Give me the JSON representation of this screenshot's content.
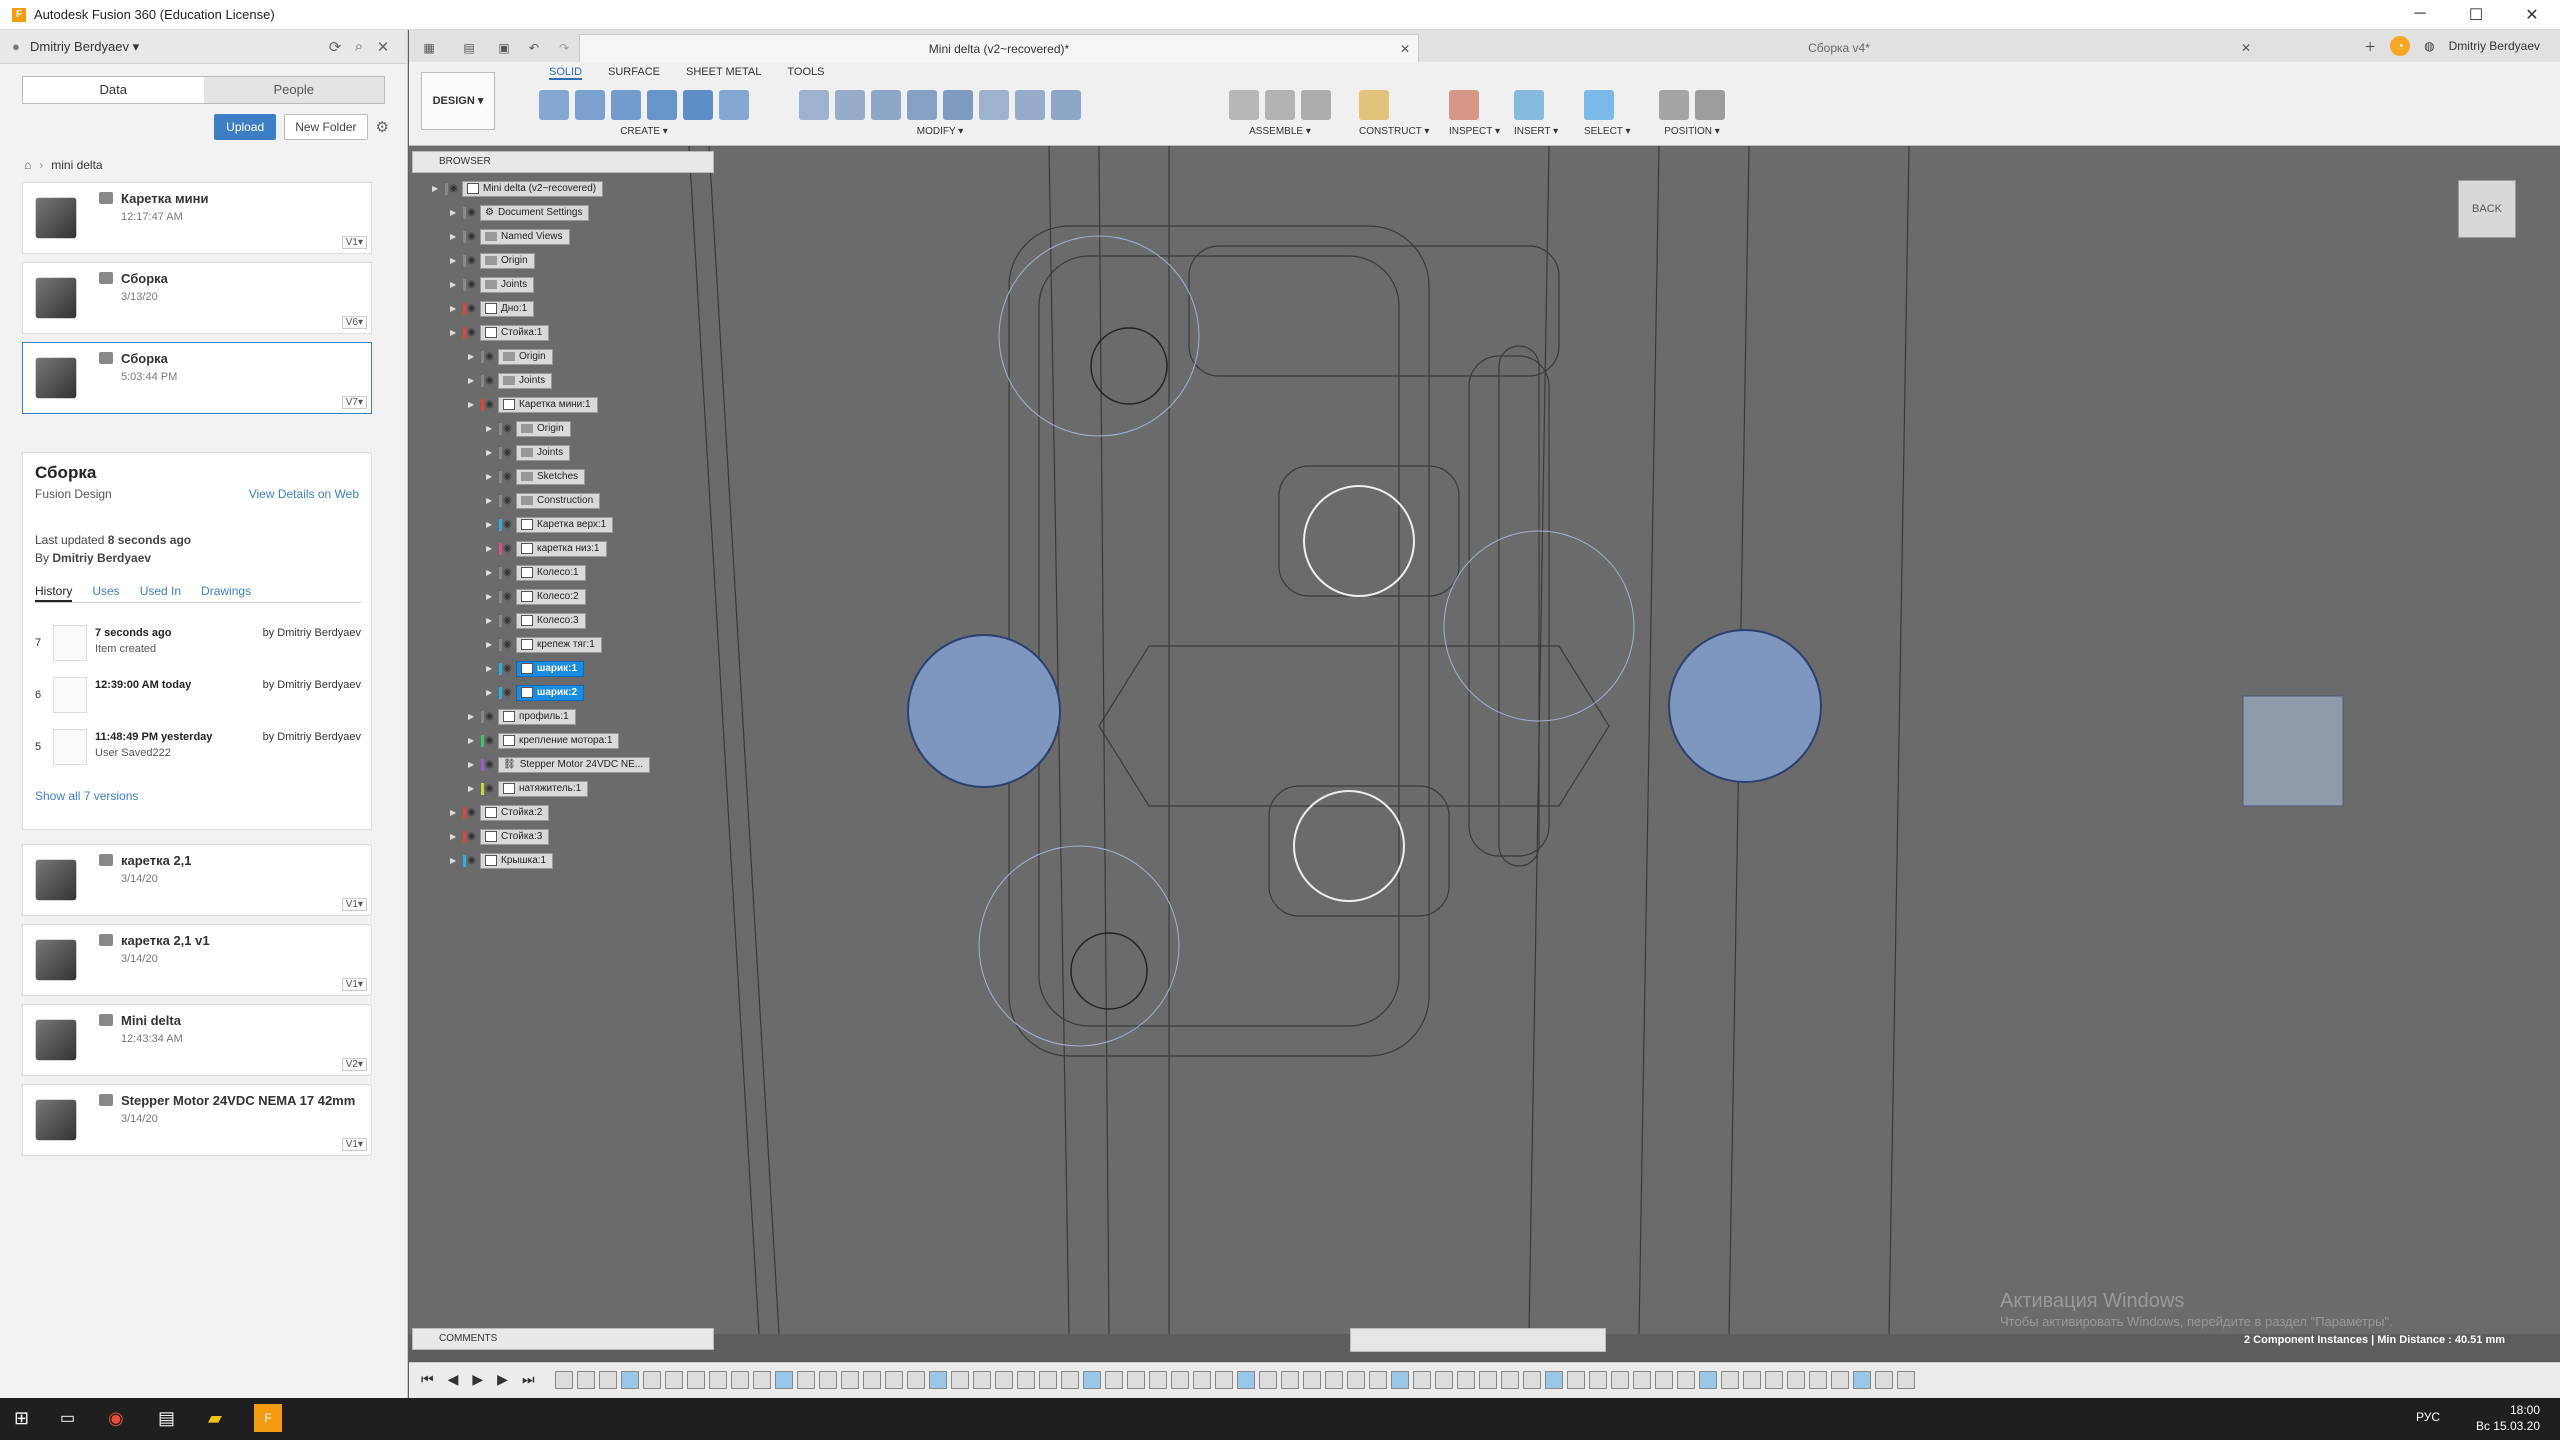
{
  "window": {
    "title": "Autodesk Fusion 360 (Education License)",
    "minimize": "─",
    "maximize": "☐",
    "close": "✕"
  },
  "left_panel": {
    "user": "Dmitriy Berdyaev ▾",
    "tabs": [
      "Data",
      "People"
    ],
    "upload": "Upload",
    "new_folder": "New Folder",
    "breadcrumb": "mini delta",
    "files_top": [
      {
        "name": "Каретка мини",
        "date": "12:17:47 AM",
        "version": "V1▾"
      },
      {
        "name": "Сборка",
        "date": "3/13/20",
        "version": "V6▾"
      },
      {
        "name": "Сборка",
        "date": "5:03:44 PM",
        "version": "V7▾"
      }
    ],
    "details": {
      "title": "Сборка",
      "type": "Fusion Design",
      "view_link": "View Details on Web",
      "updated_label": "Last updated",
      "updated_value": "8 seconds ago",
      "by_label": "By",
      "by_value": "Dmitriy Berdyaev",
      "tabs": [
        "History",
        "Uses",
        "Used In",
        "Drawings"
      ],
      "history": [
        {
          "n": "7",
          "time": "7 seconds ago",
          "note": "Item created",
          "by": "by Dmitriy Berdyaev"
        },
        {
          "n": "6",
          "time": "12:39:00 AM today",
          "note": "",
          "by": "by Dmitriy Berdyaev"
        },
        {
          "n": "5",
          "time": "11:48:49 PM yesterday",
          "note": "User Saved222",
          "by": "by Dmitriy Berdyaev"
        }
      ],
      "show_all": "Show all 7 versions"
    },
    "files_bottom": [
      {
        "name": "каретка 2,1",
        "date": "3/14/20",
        "version": "V1▾"
      },
      {
        "name": "каретка 2,1 v1",
        "date": "3/14/20",
        "version": "V1▾"
      },
      {
        "name": "Mini delta",
        "date": "12:43:34 AM",
        "version": "V2▾"
      },
      {
        "name": "Stepper Motor 24VDC NEMA 17 42mm",
        "date": "3/14/20",
        "version": "V1▾"
      }
    ]
  },
  "doc_tabs": {
    "active": "Mini delta (v2~recovered)*",
    "inactive": "Сборка v4*",
    "user": "Dmitriy Berdyaev"
  },
  "toolbar": {
    "workspace": "DESIGN ▾",
    "tabs": [
      "SOLID",
      "SURFACE",
      "SHEET METAL",
      "TOOLS"
    ],
    "groups": [
      {
        "label": "CREATE ▾",
        "count": 6
      },
      {
        "label": "MODIFY ▾",
        "count": 8
      },
      {
        "label": "ASSEMBLE ▾",
        "count": 3
      },
      {
        "label": "CONSTRUCT ▾",
        "count": 1
      },
      {
        "label": "INSPECT ▾",
        "count": 1
      },
      {
        "label": "INSERT ▾",
        "count": 1
      },
      {
        "label": "SELECT ▾",
        "count": 1
      },
      {
        "label": "POSITION ▾",
        "count": 2
      }
    ]
  },
  "browser": {
    "title": "BROWSER",
    "nodes": [
      {
        "label": "Mini delta (v2~recovered)",
        "indent": 0,
        "icon": "component",
        "color": "#888888",
        "hl": false
      },
      {
        "label": "Document Settings",
        "indent": 1,
        "icon": "gear",
        "color": "#888888",
        "hl": false
      },
      {
        "label": "Named Views",
        "indent": 1,
        "icon": "folder",
        "color": "#888888",
        "hl": false
      },
      {
        "label": "Origin",
        "indent": 1,
        "icon": "folder",
        "color": "#888888",
        "hl": false
      },
      {
        "label": "Joints",
        "indent": 1,
        "icon": "folder",
        "color": "#888888",
        "hl": false
      },
      {
        "label": "Дно:1",
        "indent": 1,
        "icon": "component",
        "color": "#e0453a",
        "hl": false
      },
      {
        "label": "Стойка:1",
        "indent": 1,
        "icon": "component",
        "color": "#e0453a",
        "hl": false
      },
      {
        "label": "Origin",
        "indent": 2,
        "icon": "folder",
        "color": "#888888",
        "hl": false
      },
      {
        "label": "Joints",
        "indent": 2,
        "icon": "folder",
        "color": "#888888",
        "hl": false
      },
      {
        "label": "Каретка мини:1",
        "indent": 2,
        "icon": "component",
        "color": "#e0453a",
        "hl": false
      },
      {
        "label": "Origin",
        "indent": 3,
        "icon": "folder",
        "color": "#888888",
        "hl": false
      },
      {
        "label": "Joints",
        "indent": 3,
        "icon": "folder",
        "color": "#888888",
        "hl": false
      },
      {
        "label": "Sketches",
        "indent": 3,
        "icon": "folder",
        "color": "#888888",
        "hl": false
      },
      {
        "label": "Construction",
        "indent": 3,
        "icon": "folder",
        "color": "#888888",
        "hl": false
      },
      {
        "label": "Каретка верх:1",
        "indent": 3,
        "icon": "component",
        "color": "#2ab0e0",
        "hl": false
      },
      {
        "label": "каретка низ:1",
        "indent": 3,
        "icon": "component",
        "color": "#e04a8c",
        "hl": false
      },
      {
        "label": "Колесо:1",
        "indent": 3,
        "icon": "component",
        "color": "#888888",
        "hl": false
      },
      {
        "label": "Колесо:2",
        "indent": 3,
        "icon": "component",
        "color": "#888888",
        "hl": false
      },
      {
        "label": "Колесо:3",
        "indent": 3,
        "icon": "component",
        "color": "#888888",
        "hl": false
      },
      {
        "label": "крепеж тяг:1",
        "indent": 3,
        "icon": "component",
        "color": "#888888",
        "hl": false
      },
      {
        "label": "шарик:1",
        "indent": 3,
        "icon": "component",
        "color": "#2ab0e0",
        "hl": true
      },
      {
        "label": "шарик:2",
        "indent": 3,
        "icon": "component",
        "color": "#2ab0e0",
        "hl": true
      },
      {
        "label": "профиль:1",
        "indent": 2,
        "icon": "component",
        "color": "#888888",
        "hl": false
      },
      {
        "label": "крепление мотора:1",
        "indent": 2,
        "icon": "component",
        "color": "#3cc06a",
        "hl": false
      },
      {
        "label": "Stepper Motor 24VDC NE...",
        "indent": 2,
        "icon": "link",
        "color": "#a05ad0",
        "hl": false
      },
      {
        "label": "натяжитель:1",
        "indent": 2,
        "icon": "component",
        "color": "#c7d83a",
        "hl": false
      },
      {
        "label": "Стойка:2",
        "indent": 1,
        "icon": "component",
        "color": "#e0453a",
        "hl": false
      },
      {
        "label": "Стойка:3",
        "indent": 1,
        "icon": "component",
        "color": "#e0453a",
        "hl": false
      },
      {
        "label": "Крышка:1",
        "indent": 1,
        "icon": "component",
        "color": "#2ab0e0",
        "hl": false
      }
    ]
  },
  "comments": "COMMENTS",
  "viewcube": "BACK",
  "status": "2 Component Instances | Min Distance : 40.51 mm",
  "watermark": {
    "line1": "Активация Windows",
    "line2": "Чтобы активировать Windows, перейдите в раздел \"Параметры\"."
  },
  "taskbar": {
    "lang": "РУС",
    "time": "18:00",
    "date": "Вс 15.03.20"
  },
  "colors": {
    "accent": "#3d7ec4",
    "highlight": "#1b8ce3",
    "ball": "#7f96bf"
  }
}
